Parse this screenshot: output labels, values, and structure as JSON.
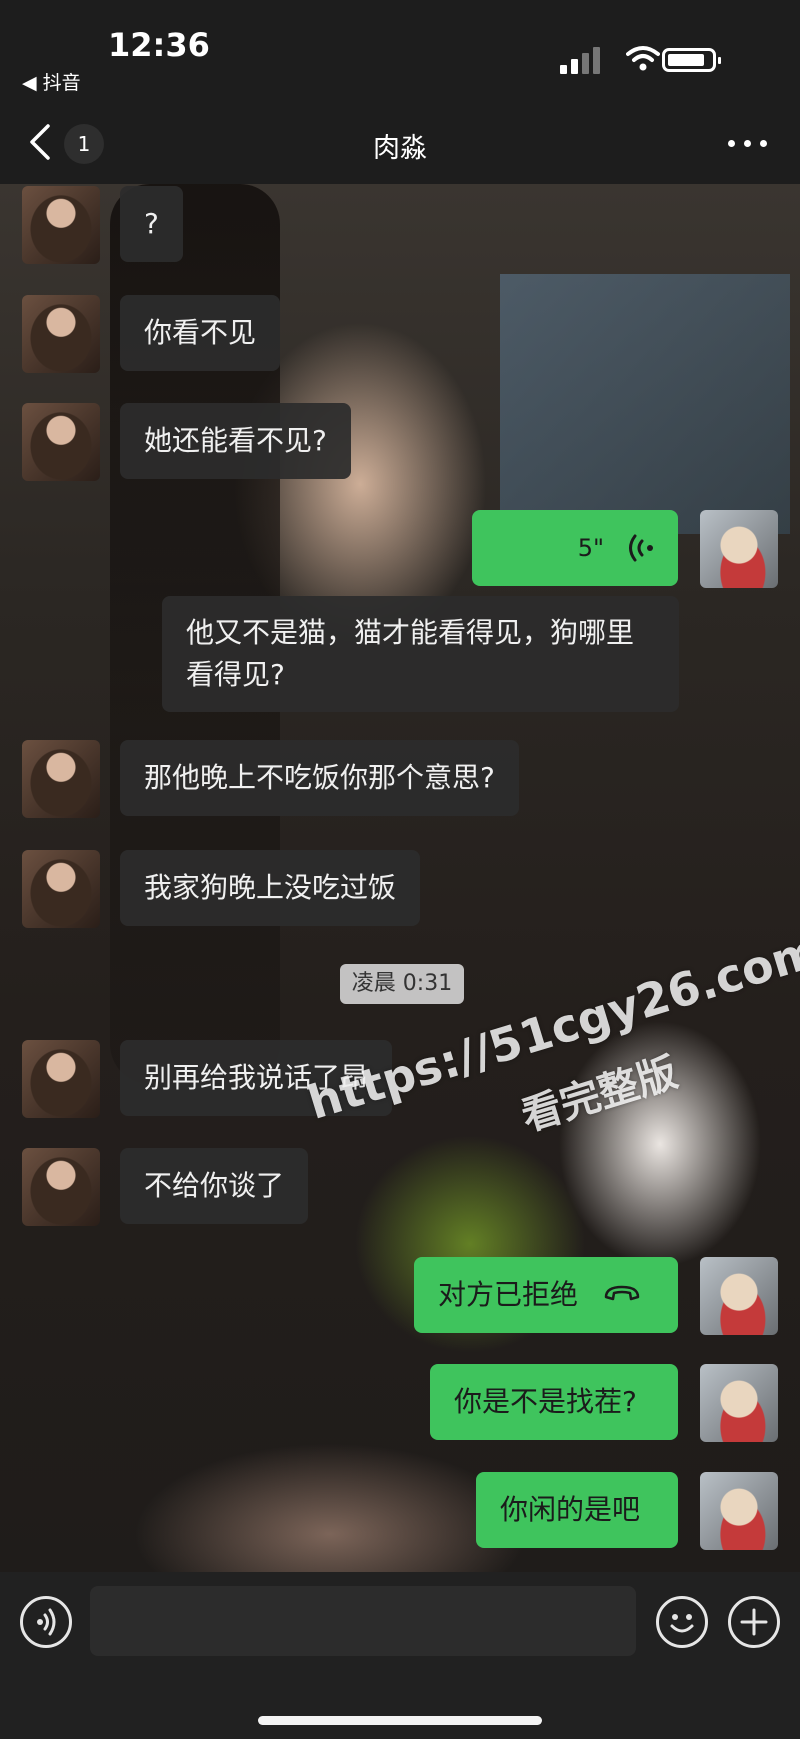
{
  "status_bar": {
    "time": "12:36",
    "back_app": "◀ 抖音",
    "icons": [
      "signal-icon",
      "wifi-icon",
      "battery-icon"
    ]
  },
  "nav": {
    "unread_count": "1",
    "title": "肉淼",
    "icons": [
      "chevron-left-icon",
      "more-icon"
    ]
  },
  "messages": [
    {
      "from": "them",
      "text": "?"
    },
    {
      "from": "them",
      "text": "你看不见"
    },
    {
      "from": "them",
      "text": "她还能看不见?"
    },
    {
      "from": "me",
      "type": "voice",
      "duration": "5\""
    },
    {
      "from": "them",
      "text": "他又不是猫，猫才能看得见，狗哪里看得见?"
    },
    {
      "from": "them",
      "text": "那他晚上不吃饭你那个意思?"
    },
    {
      "from": "them",
      "text": "我家狗晚上没吃过饭"
    },
    {
      "type": "timestamp",
      "text": "凌晨 0:31"
    },
    {
      "from": "them",
      "text": "别再给我说话了昂"
    },
    {
      "from": "them",
      "text": "不给你谈了"
    },
    {
      "from": "me",
      "type": "call",
      "text": "对方已拒绝"
    },
    {
      "from": "me",
      "text": "你是不是找茬?"
    },
    {
      "from": "me",
      "text": "你闲的是吧"
    }
  ],
  "watermark": {
    "url": "https://51cgy26.com",
    "subtitle": "看完整版"
  },
  "input_bar": {
    "placeholder": "",
    "icons": [
      "voice-input-icon",
      "emoji-icon",
      "add-icon"
    ]
  },
  "colors": {
    "outgoing_bubble": "#3fc45d",
    "incoming_bubble": "#2c2c2c",
    "background": "#1b1b1b"
  }
}
